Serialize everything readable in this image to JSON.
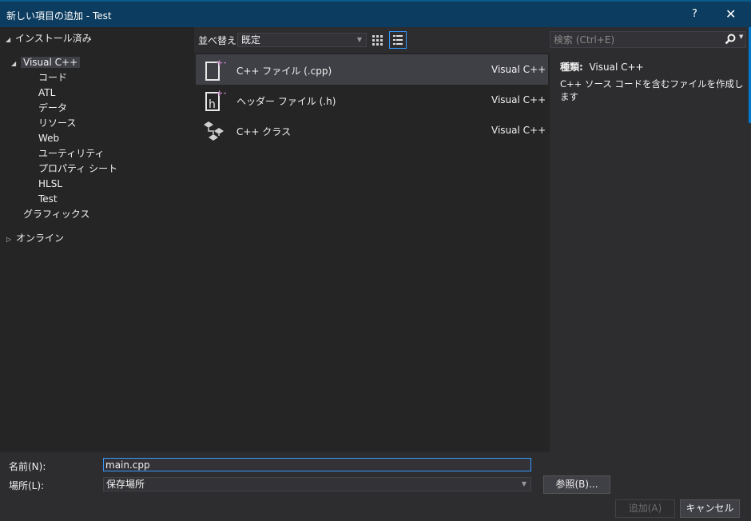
{
  "window": {
    "title": "新しい項目の追加 - Test",
    "help_label": "?",
    "close_label": "✕"
  },
  "tree": {
    "installed_label": "インストール済み",
    "visual_cpp_label": "Visual C++",
    "children": [
      "コード",
      "ATL",
      "データ",
      "リソース",
      "Web",
      "ユーティリティ",
      "プロパティ シート",
      "HLSL",
      "Test"
    ],
    "graphics_label": "グラフィックス",
    "online_label": "オンライン"
  },
  "toolbar": {
    "sort_label": "並べ替え:",
    "sort_value": "既定"
  },
  "search": {
    "placeholder": "検索 (Ctrl+E)"
  },
  "items": [
    {
      "name": "C++ ファイル (.cpp)",
      "lang": "Visual C++",
      "icon": "cpp-file-icon"
    },
    {
      "name": "ヘッダー ファイル (.h)",
      "lang": "Visual C++",
      "icon": "header-file-icon"
    },
    {
      "name": "C++ クラス",
      "lang": "Visual C++",
      "icon": "cpp-class-icon"
    }
  ],
  "details": {
    "type_label": "種類:",
    "type_value": "Visual C++",
    "description": "C++ ソース コードを含むファイルを作成します"
  },
  "form": {
    "name_label": "名前(N):",
    "name_value": "main.cpp",
    "location_label": "場所(L):",
    "location_value": "保存場所",
    "browse_label": "参照(B)...",
    "add_label": "追加(A)",
    "cancel_label": "キャンセル"
  },
  "colors": {
    "accent": "#007acc",
    "title_bg": "#0c3c5f",
    "pane_bg": "#252526",
    "selection": "#3f3f46"
  }
}
